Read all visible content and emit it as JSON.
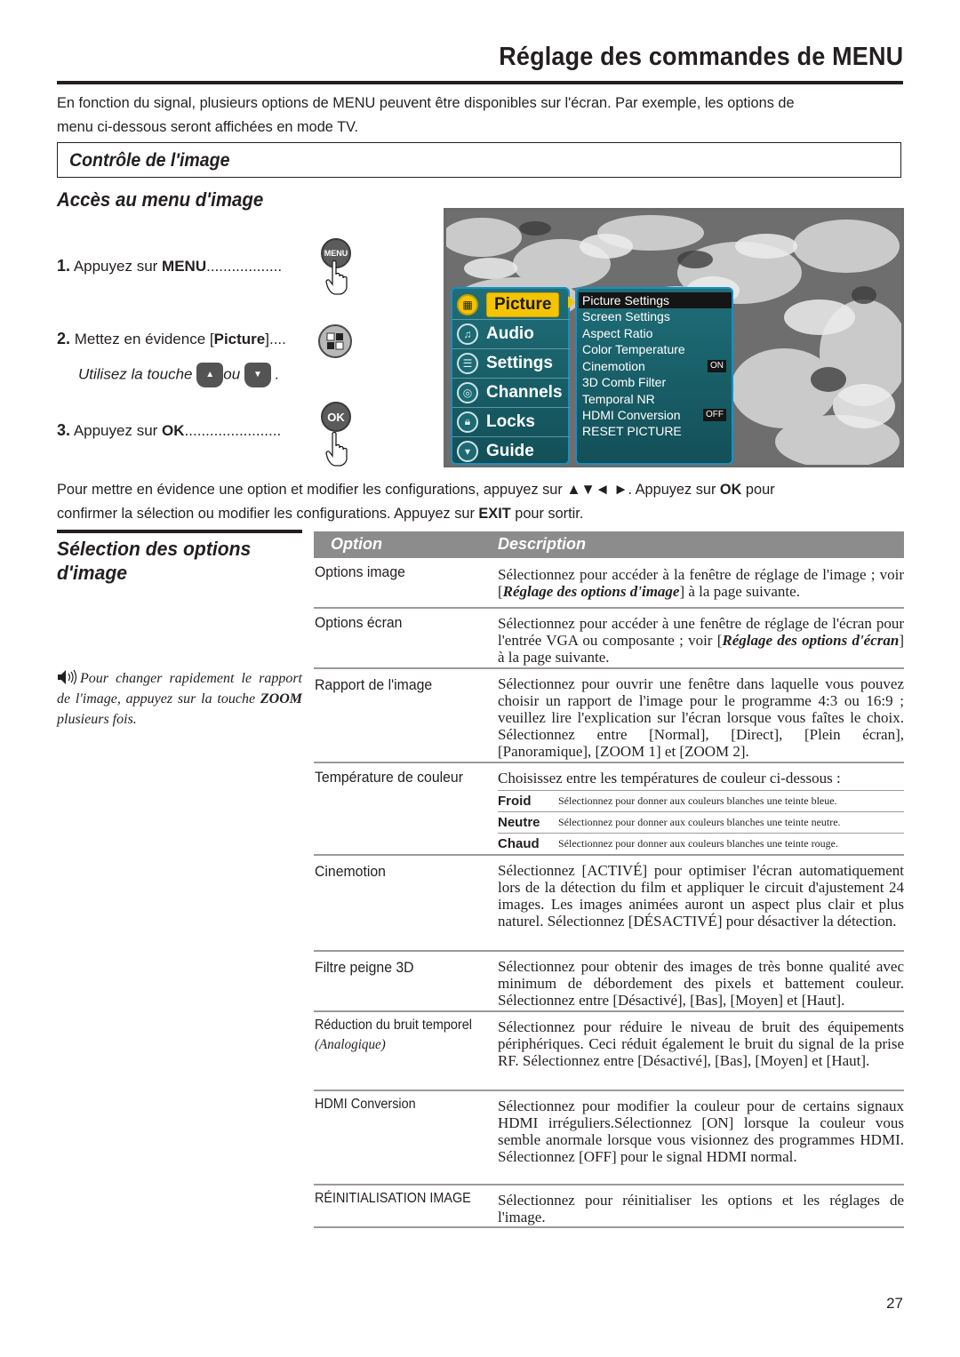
{
  "header": {
    "title": "Réglage des commandes de MENU",
    "intro_line1": "En fonction du signal, plusieurs options de MENU peuvent être disponibles sur l'écran. Par exemple, les options de",
    "intro_line2": "menu ci-dessous seront affichées en mode TV."
  },
  "section": {
    "title": "Contrôle de l'image",
    "subtitle": "Accès au menu d'image"
  },
  "steps": [
    {
      "number": "1.",
      "text": "Appuyez sur ",
      "keyword": "MENU",
      "dots": "..................",
      "button": "MENU"
    },
    {
      "number": "2.",
      "text": "Mettez en évidence [",
      "keyword": "Picture",
      "suffix": "]....",
      "hint": "Utilisez la touche",
      "hint_or": "ou",
      "hint_end": "."
    },
    {
      "number": "3.",
      "text": "Appuyez sur ",
      "keyword": "OK",
      "dots": ".......................",
      "button": "OK"
    }
  ],
  "tv_menu": {
    "main_items": [
      {
        "label": "Picture",
        "icon": "picture-icon",
        "active": true
      },
      {
        "label": "Audio",
        "icon": "audio-icon"
      },
      {
        "label": "Settings",
        "icon": "settings-icon"
      },
      {
        "label": "Channels",
        "icon": "channels-icon"
      },
      {
        "label": "Locks",
        "icon": "lock-icon"
      },
      {
        "label": "Guide",
        "icon": "guide-icon"
      }
    ],
    "sub_items": [
      {
        "label": "Picture Settings",
        "selected": true
      },
      {
        "label": "Screen Settings"
      },
      {
        "label": "Aspect Ratio"
      },
      {
        "label": "Color Temperature"
      },
      {
        "label": "Cinemotion",
        "value": "ON"
      },
      {
        "label": "3D Comb Filter"
      },
      {
        "label": "Temporal NR"
      },
      {
        "label": "HDMI Conversion",
        "value": "OFF"
      },
      {
        "label": "RESET PICTURE"
      }
    ]
  },
  "instructions": {
    "line1_a": "Pour mettre en évidence une option et modifier les configurations, appuyez sur ▲▼◄ ►. Appuyez sur ",
    "line1_b": "OK",
    "line1_c": " pour",
    "line2_a": "confirmer la sélection ou modifier les configurations. Appuyez sur ",
    "line2_b": "EXIT",
    "line2_c": " pour sortir."
  },
  "selection": {
    "title": "Sélection des options d'image",
    "note_a": "Pour changer rapidement le rapport de l'image, appuyez sur la touche ",
    "note_b": "ZOOM",
    "note_c": " plusieurs fois."
  },
  "table": {
    "headers": {
      "option": "Option",
      "description": "Description"
    },
    "rows": [
      {
        "option": "Options image",
        "desc_a": "Sélectionnez pour accéder à la fenêtre de réglage de l'image ; voir [",
        "desc_em": "Réglage des options d'image",
        "desc_b": "] à la page suivante."
      },
      {
        "option": "Options écran",
        "desc_a": "Sélectionnez pour accéder à une fenêtre de réglage de l'écran pour l'entrée VGA ou composante ; voir [",
        "desc_em": "Réglage des options d'écran",
        "desc_b": "] à la page suivante."
      },
      {
        "option": "Rapport de l'image",
        "desc": "Sélectionnez pour ouvrir une fenêtre dans laquelle vous pouvez choisir un rapport de l'image pour le programme 4:3 ou 16:9 ; veuillez lire l'explication sur l'écran lorsque vous faîtes le choix. Sélectionnez entre [Normal], [Direct], [Plein écran], [Panoramique], [ZOOM 1] et [ZOOM 2]."
      },
      {
        "option": "Température de couleur",
        "desc": "Choisissez entre les températures de couleur ci-dessous :",
        "sub_options": [
          {
            "name": "Froid",
            "desc": "Sélectionnez pour donner aux couleurs blanches une teinte bleue."
          },
          {
            "name": "Neutre",
            "desc": "Sélectionnez pour donner aux couleurs blanches une teinte neutre."
          },
          {
            "name": "Chaud",
            "desc": "Sélectionnez pour donner aux couleurs blanches une teinte rouge."
          }
        ]
      },
      {
        "option": "Cinemotion",
        "desc": "Sélectionnez [ACTIVÉ] pour optimiser l'écran automatiquement lors de la détection du film et appliquer le circuit d'ajustement 24 images. Les images animées auront un aspect plus clair et plus naturel. Sélectionnez [DÉSACTIVÉ] pour désactiver la détection."
      },
      {
        "option": "Filtre peigne 3D",
        "desc": "Sélectionnez pour obtenir des images de très bonne qualité avec minimum de débordement des pixels et battement couleur. Sélectionnez entre [Désactivé], [Bas], [Moyen] et [Haut]."
      },
      {
        "option": "Réduction du bruit temporel",
        "option_sub": "(Analogique)",
        "desc": "Sélectionnez pour réduire le niveau de bruit des équipements périphériques. Ceci réduit également le bruit du signal de la prise RF. Sélectionnez entre [Désactivé], [Bas], [Moyen] et [Haut]."
      },
      {
        "option": "HDMI Conversion",
        "desc": "Sélectionnez pour modifier la couleur pour de certains signaux HDMI irréguliers.Sélectionnez [ON] lorsque la couleur vous semble anormale lorsque vous visionnez des programmes HDMI. Sélectionnez [OFF] pour le signal HDMI normal."
      },
      {
        "option": "RÉINITIALISATION IMAGE",
        "desc": "Sélectionnez pour réinitialiser les options et les réglages de l'image."
      }
    ]
  },
  "footer": {
    "page_number": "27"
  },
  "colors": {
    "table_header": "#8c8c8c",
    "tv_panel": "#1f6e78",
    "tv_highlight": "#f5c400",
    "tv_border": "#1a8fc0"
  }
}
